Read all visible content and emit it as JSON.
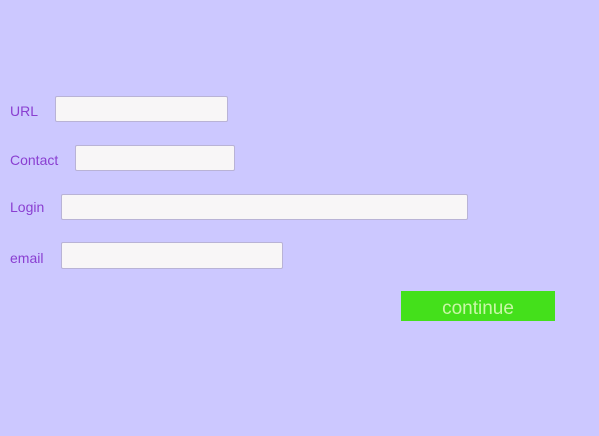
{
  "form": {
    "url": {
      "label": "URL",
      "value": "",
      "placeholder": ""
    },
    "contact": {
      "label": "Contact",
      "value": "",
      "placeholder": ""
    },
    "login": {
      "label": "Login",
      "value": "",
      "placeholder": ""
    },
    "email": {
      "label": "email",
      "value": "",
      "placeholder": ""
    },
    "continue_label": "continue"
  },
  "colors": {
    "background": "#ccc8ff",
    "label": "#8a3fd1",
    "field_background": "#f8f6f7",
    "field_border": "#b9b3d6",
    "button_background": "#44e01b",
    "button_text": "#c9f7a7"
  }
}
